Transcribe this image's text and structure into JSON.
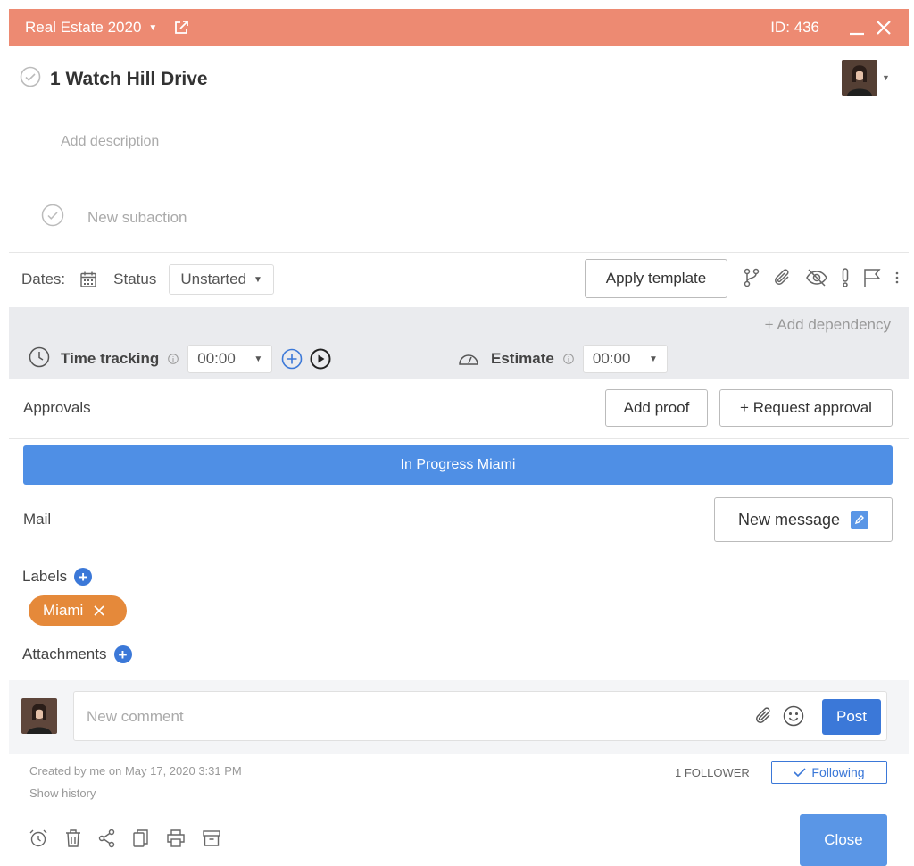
{
  "header": {
    "title": "Real Estate 2020",
    "title_caret_icon": "caret-down-icon",
    "external_link_icon": "external-link-icon",
    "id_label": "ID: 436",
    "minimize_icon": "minimize-icon",
    "close_icon": "close-icon",
    "background_color": "#ed8a72"
  },
  "task": {
    "title": "1 Watch Hill Drive",
    "complete_icon": "check-circle-icon",
    "description_placeholder": "Add description",
    "subaction_placeholder": "New subaction"
  },
  "toolbar": {
    "dates_label": "Dates:",
    "calendar_icon": "calendar-icon",
    "status_label": "Status",
    "status_value": "Unstarted",
    "apply_template_label": "Apply template",
    "icons": [
      "branch-icon",
      "paperclip-icon",
      "eye-off-icon",
      "exclamation-icon",
      "flag-icon",
      "more-vertical-icon"
    ]
  },
  "tracking": {
    "add_dependency_label": "+ Add dependency",
    "time_tracking_label": "Time tracking",
    "time_tracking_value": "00:00",
    "estimate_label": "Estimate",
    "estimate_value": "00:00"
  },
  "approvals": {
    "label": "Approvals",
    "add_proof_label": "Add proof",
    "request_approval_label": "+ Request approval"
  },
  "progress": {
    "label": "In Progress Miami",
    "color": "#4f8fe5"
  },
  "mail": {
    "label": "Mail",
    "new_message_label": "New message"
  },
  "labels": {
    "label": "Labels",
    "chips": [
      {
        "text": "Miami",
        "color": "#e5893a"
      }
    ]
  },
  "attachments": {
    "label": "Attachments"
  },
  "comment": {
    "placeholder": "New comment",
    "post_label": "Post"
  },
  "footer": {
    "created_text": "Created by me on May 17, 2020 3:31 PM",
    "show_history_label": "Show history",
    "followers_text": "1 FOLLOWER",
    "following_label": "Following",
    "close_label": "Close",
    "action_icons": [
      "alarm-clock-icon",
      "trash-icon",
      "share-icon",
      "copy-icon",
      "print-icon",
      "archive-icon"
    ]
  }
}
